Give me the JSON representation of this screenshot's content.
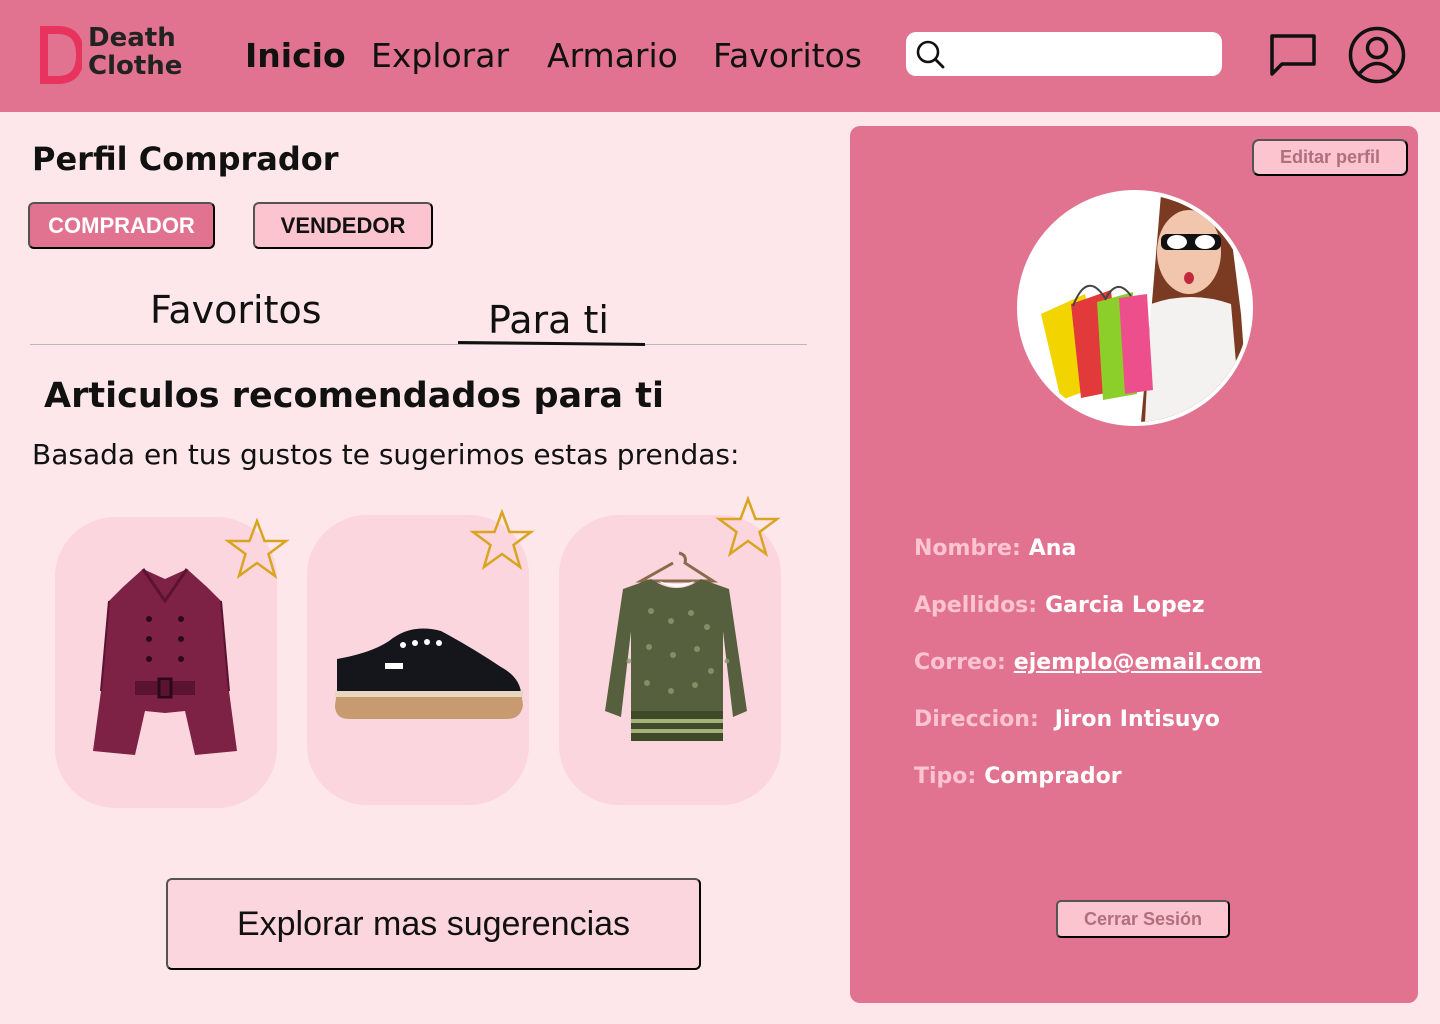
{
  "header": {
    "logo": {
      "line1": "Death",
      "line2": "Clothe",
      "accent": "#e8335f"
    },
    "nav": [
      {
        "label": "Inicio",
        "active": true
      },
      {
        "label": "Explorar",
        "active": false
      },
      {
        "label": "Armario",
        "active": false
      },
      {
        "label": "Favoritos",
        "active": false
      }
    ],
    "search": {
      "value": "",
      "placeholder": ""
    },
    "icons": [
      "search-icon",
      "chat-icon",
      "user-icon"
    ]
  },
  "profile": {
    "title": "Perfil Comprador",
    "roles": {
      "buyer": "COMPRADOR",
      "seller": "VENDEDOR"
    },
    "tabs": {
      "favorites": "Favoritos",
      "for_you": "Para ti",
      "active": "for_you"
    }
  },
  "recommendations": {
    "title": "Articulos recomendados para ti",
    "subtitle": "Basada en tus gustos te sugerimos estas prendas:",
    "items": [
      {
        "name": "trench-coat",
        "favorite_icon": "star-icon"
      },
      {
        "name": "sneaker",
        "favorite_icon": "star-icon"
      },
      {
        "name": "blouse",
        "favorite_icon": "star-icon"
      }
    ],
    "explore_button": "Explorar mas sugerencias"
  },
  "side_panel": {
    "edit_button": "Editar perfil",
    "fields": [
      {
        "label": "Nombre:",
        "value": "Ana"
      },
      {
        "label": "Apellidos:",
        "value": "Garcia Lopez"
      },
      {
        "label": "Correo:",
        "value": "ejemplo@email.com"
      },
      {
        "label": "Direccion:",
        "value": "Jiron Intisuyo"
      },
      {
        "label": "Tipo:",
        "value": "Comprador"
      }
    ],
    "logout_button": "Cerrar Sesión"
  },
  "colors": {
    "header_bg": "#e27390",
    "page_bg": "#fde7ea",
    "card_bg": "#fcd6de",
    "light_pink": "#fbc4cf",
    "star": "#d9a520"
  }
}
